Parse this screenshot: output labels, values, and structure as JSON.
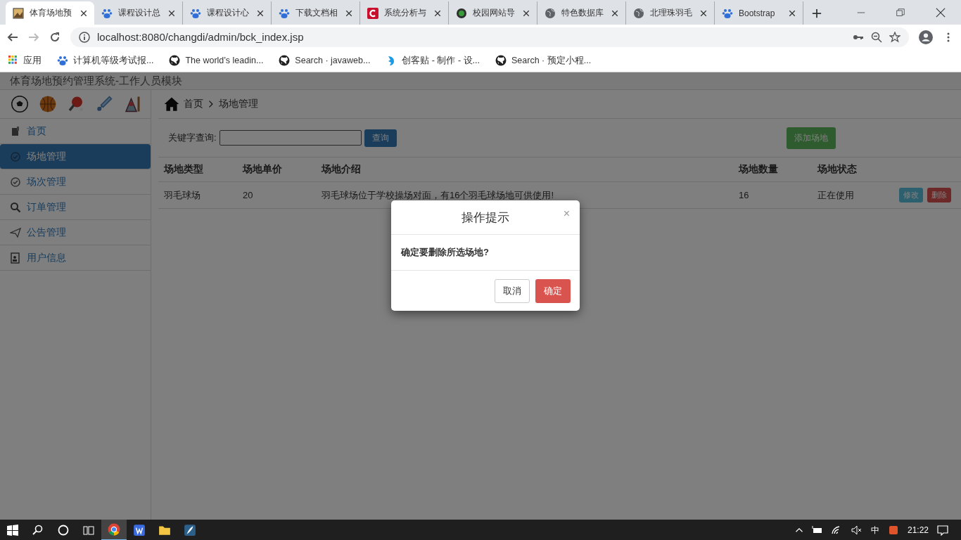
{
  "browser": {
    "tabs": [
      {
        "title": "体育场地预",
        "selected": true
      },
      {
        "title": "课程设计总",
        "selected": false
      },
      {
        "title": "课程设计心",
        "selected": false
      },
      {
        "title": "下载文档相",
        "selected": false
      },
      {
        "title": "系统分析与",
        "selected": false
      },
      {
        "title": "校园网站导",
        "selected": false
      },
      {
        "title": "特色数据库",
        "selected": false
      },
      {
        "title": "北理珠羽毛",
        "selected": false
      },
      {
        "title": "Bootstrap",
        "selected": false
      }
    ],
    "address": "localhost:8080/changdi/admin/bck_index.jsp",
    "bookmarks": [
      "应用",
      "计算机等级考试报...",
      "The world’s leadin...",
      "Search · javaweb...",
      "创客贴 - 制作 - 设...",
      "Search · 预定小程..."
    ]
  },
  "page": {
    "header_title": "体育场地预约管理系统-工作人员模块",
    "breadcrumb": [
      "首页",
      "场地管理"
    ],
    "sidebar": {
      "items": [
        {
          "label": "首页",
          "selected": false
        },
        {
          "label": "场地管理",
          "selected": true
        },
        {
          "label": "场次管理",
          "selected": false
        },
        {
          "label": "订单管理",
          "selected": false
        },
        {
          "label": "公告管理",
          "selected": false
        },
        {
          "label": "用户信息",
          "selected": false
        }
      ]
    },
    "search": {
      "label": "关键字查询:",
      "button": "查询"
    },
    "add_button": "添加场地",
    "table": {
      "columns": [
        "场地类型",
        "场地单价",
        "场地介绍",
        "场地数量",
        "场地状态"
      ],
      "rows": [
        {
          "cells": [
            "羽毛球场",
            "20",
            "羽毛球场位于学校操场对面，有16个羽毛球场地可供使用!",
            "16",
            "正在使用"
          ],
          "actions": [
            {
              "label": "修改",
              "kind": "info"
            },
            {
              "label": "删除",
              "kind": "danger"
            }
          ]
        }
      ]
    }
  },
  "dialog": {
    "title": "操作提示",
    "close": "×",
    "message": "确定要删除所选场地?",
    "buttons": [
      {
        "label": "取消",
        "kind": "default"
      },
      {
        "label": "确定",
        "kind": "danger"
      }
    ]
  },
  "taskbar": {
    "ime": "中",
    "clock": "21:22"
  }
}
